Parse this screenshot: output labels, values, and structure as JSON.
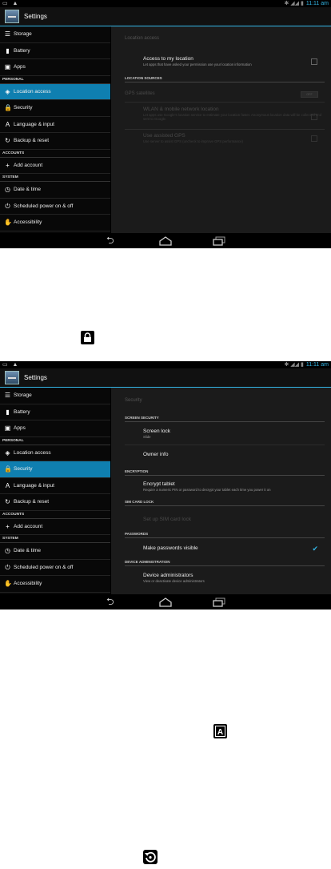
{
  "screen1": {
    "status_right_icons": [
      "bluetooth-icon",
      "signal-icon",
      "signal-icon",
      "battery-icon"
    ],
    "clock": "11:11 am",
    "app_title": "Settings",
    "sidebar": [
      {
        "type": "item",
        "icon": "storage-icon",
        "glyph": "☰",
        "label": "Storage"
      },
      {
        "type": "item",
        "icon": "battery-icon",
        "glyph": "▮",
        "label": "Battery"
      },
      {
        "type": "item",
        "icon": "apps-icon",
        "glyph": "▣",
        "label": "Apps"
      },
      {
        "type": "header",
        "label": "PERSONAL"
      },
      {
        "type": "item",
        "icon": "location-icon",
        "glyph": "◈",
        "label": "Location access",
        "selected": true
      },
      {
        "type": "item",
        "icon": "lock-icon",
        "glyph": "🔒",
        "label": "Security"
      },
      {
        "type": "item",
        "icon": "language-icon",
        "glyph": "A",
        "label": "Language & input"
      },
      {
        "type": "item",
        "icon": "backup-icon",
        "glyph": "↻",
        "label": "Backup & reset"
      },
      {
        "type": "header",
        "label": "ACCOUNTS"
      },
      {
        "type": "item",
        "icon": "add-icon",
        "glyph": "+",
        "label": "Add account"
      },
      {
        "type": "header",
        "label": "SYSTEM"
      },
      {
        "type": "item",
        "icon": "clock-icon",
        "glyph": "◷",
        "label": "Date & time"
      },
      {
        "type": "item",
        "icon": "power-icon",
        "glyph": "⏻",
        "label": "Scheduled power on & off"
      },
      {
        "type": "item",
        "icon": "hand-icon",
        "glyph": "✋",
        "label": "Accessibility"
      }
    ],
    "content": {
      "title": "Location access",
      "access_title": "Access to my location",
      "access_sub": "Let apps that have asked your permission use your location information",
      "section": "LOCATION SOURCES",
      "gps_label": "GPS satellites",
      "gps_toggle": "OFF",
      "wlan_title": "WLAN & mobile network location",
      "wlan_sub": "Let apps use Google's location service to estimate your location faster. Anonymous location data will be collected and sent to Google.",
      "agps_title": "Use assisted GPS",
      "agps_sub": "Use server to assist GPS (uncheck to improve GPS performance)"
    }
  },
  "screen2": {
    "clock": "11:11 am",
    "app_title": "Settings",
    "sidebar": [
      {
        "type": "item",
        "icon": "storage-icon",
        "glyph": "☰",
        "label": "Storage"
      },
      {
        "type": "item",
        "icon": "battery-icon",
        "glyph": "▮",
        "label": "Battery"
      },
      {
        "type": "item",
        "icon": "apps-icon",
        "glyph": "▣",
        "label": "Apps"
      },
      {
        "type": "header",
        "label": "PERSONAL"
      },
      {
        "type": "item",
        "icon": "location-icon",
        "glyph": "◈",
        "label": "Location access"
      },
      {
        "type": "item",
        "icon": "lock-icon",
        "glyph": "🔒",
        "label": "Security",
        "selected": true
      },
      {
        "type": "item",
        "icon": "language-icon",
        "glyph": "A",
        "label": "Language & input"
      },
      {
        "type": "item",
        "icon": "backup-icon",
        "glyph": "↻",
        "label": "Backup & reset"
      },
      {
        "type": "header",
        "label": "ACCOUNTS"
      },
      {
        "type": "item",
        "icon": "add-icon",
        "glyph": "+",
        "label": "Add account"
      },
      {
        "type": "header",
        "label": "SYSTEM"
      },
      {
        "type": "item",
        "icon": "clock-icon",
        "glyph": "◷",
        "label": "Date & time"
      },
      {
        "type": "item",
        "icon": "power-icon",
        "glyph": "⏻",
        "label": "Scheduled power on & off"
      },
      {
        "type": "item",
        "icon": "hand-icon",
        "glyph": "✋",
        "label": "Accessibility"
      }
    ],
    "content": {
      "title": "Security",
      "sec_screen": "SCREEN SECURITY",
      "screen_lock_title": "Screen lock",
      "screen_lock_sub": "Slide",
      "owner_info": "Owner info",
      "sec_encryption": "ENCRYPTION",
      "encrypt_title": "Encrypt tablet",
      "encrypt_sub": "Require a numeric PIN or password to decrypt your tablet each time you power it on",
      "sec_sim": "SIM CARD LOCK",
      "sim_lock": "Set up SIM card lock",
      "sec_passwords": "PASSWORDS",
      "passwords_visible": "Make passwords visible",
      "sec_admin": "DEVICE ADMINISTRATION",
      "device_admin_title": "Device administrators",
      "device_admin_sub": "View or deactivate device administrators"
    }
  },
  "standalone_icons": [
    {
      "name": "lock-icon",
      "glyph": "🔒"
    },
    {
      "name": "language-icon",
      "glyph": "A"
    },
    {
      "name": "backup-icon",
      "glyph": "↻"
    }
  ]
}
